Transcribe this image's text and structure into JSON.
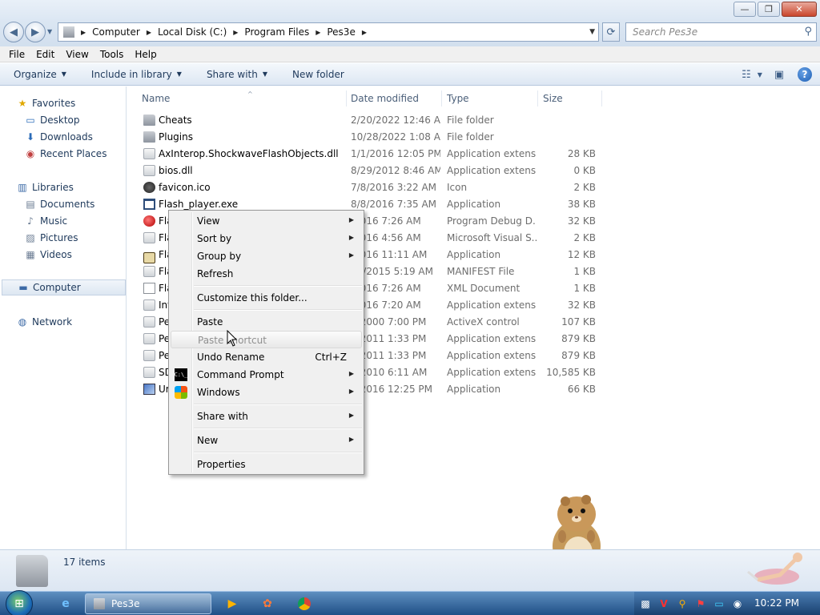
{
  "window": {
    "minimize_glyph": "—",
    "maximize_glyph": "❐",
    "close_glyph": "✕"
  },
  "address": {
    "crumbs": [
      "Computer",
      "Local Disk (C:)",
      "Program Files",
      "Pes3e"
    ],
    "search_placeholder": "Search Pes3e"
  },
  "menubar": {
    "items": [
      "File",
      "Edit",
      "View",
      "Tools",
      "Help"
    ]
  },
  "commands": {
    "organize": "Organize",
    "include_in_library": "Include in library",
    "share_with": "Share with",
    "new_folder": "New folder"
  },
  "navpane": {
    "favorites": "Favorites",
    "desktop": "Desktop",
    "downloads": "Downloads",
    "recent_places": "Recent Places",
    "libraries": "Libraries",
    "documents": "Documents",
    "music": "Music",
    "pictures": "Pictures",
    "videos": "Videos",
    "computer": "Computer",
    "network": "Network"
  },
  "columns": {
    "name": "Name",
    "date": "Date modified",
    "type": "Type",
    "size": "Size"
  },
  "files": [
    {
      "name": "Cheats",
      "date": "2/20/2022 12:46 AM",
      "type": "File folder",
      "size": "",
      "icon": "folder"
    },
    {
      "name": "Plugins",
      "date": "10/28/2022 1:08 AM",
      "type": "File folder",
      "size": "",
      "icon": "folder"
    },
    {
      "name": "AxInterop.ShockwaveFlashObjects.dll",
      "date": "1/1/2016 12:05 PM",
      "type": "Application extens...",
      "size": "28 KB",
      "icon": "file"
    },
    {
      "name": "bios.dll",
      "date": "8/29/2012 8:46 AM",
      "type": "Application extens...",
      "size": "0 KB",
      "icon": "file"
    },
    {
      "name": "favicon.ico",
      "date": "7/8/2016 3:22 AM",
      "type": "Icon",
      "size": "2 KB",
      "icon": "ico"
    },
    {
      "name": "Flash_player.exe",
      "date": "8/8/2016 7:35 AM",
      "type": "Application",
      "size": "38 KB",
      "icon": "app"
    },
    {
      "name": "Fla",
      "date": "/2016 7:26 AM",
      "type": "Program Debug D...",
      "size": "32 KB",
      "icon": "red"
    },
    {
      "name": "Fla",
      "date": "/2016 4:56 AM",
      "type": "Microsoft Visual S...",
      "size": "2 KB",
      "icon": "file"
    },
    {
      "name": "Fla",
      "date": "/2016 11:11 AM",
      "type": "Application",
      "size": "12 KB",
      "icon": "clock"
    },
    {
      "name": "Fla",
      "date": "30/2015 5:19 AM",
      "type": "MANIFEST File",
      "size": "1 KB",
      "icon": "file"
    },
    {
      "name": "Fla",
      "date": "/2016 7:26 AM",
      "type": "XML Document",
      "size": "1 KB",
      "icon": "xml"
    },
    {
      "name": "Int",
      "date": "/2016 7:20 AM",
      "type": "Application extens...",
      "size": "32 KB",
      "icon": "file"
    },
    {
      "name": "Pe",
      "date": "4/2000 7:00 PM",
      "type": "ActiveX control",
      "size": "107 KB",
      "icon": "file"
    },
    {
      "name": "Pe",
      "date": "7/2011 1:33 PM",
      "type": "Application extens...",
      "size": "879 KB",
      "icon": "file"
    },
    {
      "name": "Pe",
      "date": "7/2011 1:33 PM",
      "type": "Application extens...",
      "size": "879 KB",
      "icon": "file"
    },
    {
      "name": "SD",
      "date": "2/2010 6:11 AM",
      "type": "Application extens...",
      "size": "10,585 KB",
      "icon": "file"
    },
    {
      "name": "Ur",
      "date": "5/2016 12:25 PM",
      "type": "Application",
      "size": "66 KB",
      "icon": "setup"
    }
  ],
  "context_menu": {
    "view": "View",
    "sort_by": "Sort by",
    "group_by": "Group by",
    "refresh": "Refresh",
    "customize": "Customize this folder...",
    "paste": "Paste",
    "paste_shortcut": "Paste shortcut",
    "undo_rename": "Undo Rename",
    "undo_rename_key": "Ctrl+Z",
    "command_prompt": "Command Prompt",
    "windows": "Windows",
    "share_with": "Share with",
    "new": "New",
    "properties": "Properties",
    "cmd_icon_text": "C:\\_"
  },
  "status": {
    "item_count": "17 items"
  },
  "taskbar": {
    "task_label": "Pes3e",
    "clock": "10:22 PM"
  },
  "colors": {
    "accent": "#1e395b",
    "selection": "#dde7f2",
    "taskbar": "#1f4f86"
  }
}
